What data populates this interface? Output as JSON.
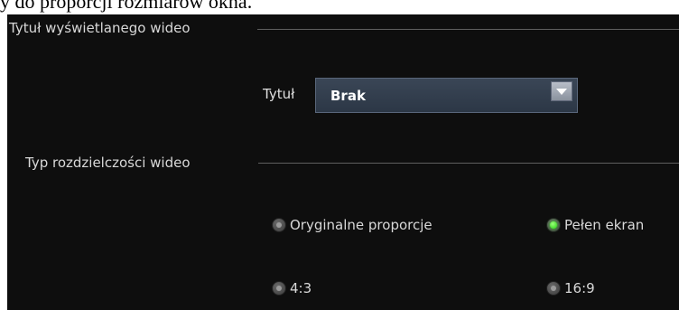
{
  "top_text": "y do proporcji rozmiarów okna.",
  "video_title_section": {
    "title": "Tytuł wyświetlanego wideo",
    "field_label": "Tytuł",
    "select_value": "Brak"
  },
  "resolution_section": {
    "title": "Typ rozdzielczości wideo",
    "options": [
      {
        "label": "Oryginalne proporcje",
        "checked": false
      },
      {
        "label": "Pełen ekran",
        "checked": true
      },
      {
        "label": "4:3",
        "checked": false
      },
      {
        "label": "16:9",
        "checked": false
      }
    ]
  },
  "colors": {
    "panel_background": "#0e0e0e",
    "selected_radio": "#22d10e",
    "select_background": "#2c3746"
  },
  "icons": [
    "dropdown-arrow-icon"
  ]
}
